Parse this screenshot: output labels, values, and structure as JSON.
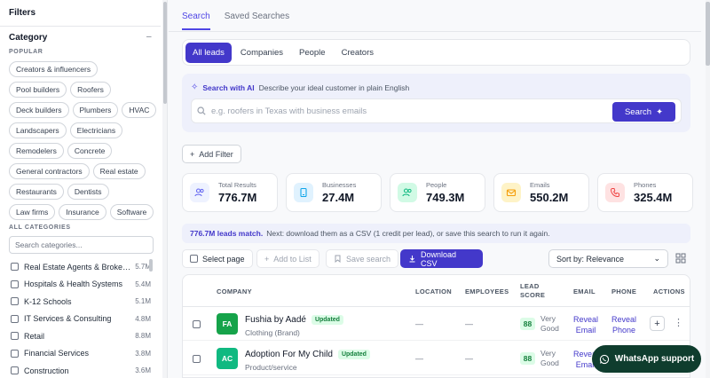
{
  "sidebar": {
    "title": "Filters",
    "category_title": "Category",
    "collapse_icon": "minus-icon",
    "popular_label": "POPULAR",
    "popular_chips": [
      "Creators & influencers",
      "Pool builders",
      "Roofers",
      "Deck builders",
      "Plumbers",
      "HVAC",
      "Landscapers",
      "Electricians",
      "Remodelers",
      "Concrete",
      "General contractors",
      "Real estate",
      "Restaurants",
      "Dentists",
      "Law firms",
      "Insurance",
      "Software"
    ],
    "all_categories_label": "ALL CATEGORIES",
    "search_placeholder": "Search categories...",
    "categories": [
      {
        "name": "Real Estate Agents & Broke…",
        "count": "5.7M"
      },
      {
        "name": "Hospitals & Health Systems",
        "count": "5.4M"
      },
      {
        "name": "K-12 Schools",
        "count": "5.1M"
      },
      {
        "name": "IT Services & Consulting",
        "count": "4.8M"
      },
      {
        "name": "Retail",
        "count": "8.8M"
      },
      {
        "name": "Financial Services",
        "count": "3.8M"
      },
      {
        "name": "Construction",
        "count": "3.6M"
      }
    ]
  },
  "tabs": [
    "Search",
    "Saved Searches"
  ],
  "segments": [
    "All leads",
    "Companies",
    "People",
    "Creators"
  ],
  "ai": {
    "label": "Search with AI",
    "description": "Describe your ideal customer in plain English",
    "placeholder": "e.g. roofers in Texas with business emails",
    "button": "Search"
  },
  "add_filter": "Add Filter",
  "stats": [
    {
      "label": "Total Results",
      "value": "776.7M",
      "icon": "users-icon",
      "color": "#6366f1",
      "bg": "#eef2ff"
    },
    {
      "label": "Businesses",
      "value": "27.4M",
      "icon": "building-icon",
      "color": "#0ea5e9",
      "bg": "#e0f2fe"
    },
    {
      "label": "People",
      "value": "749.3M",
      "icon": "people-icon",
      "color": "#10b981",
      "bg": "#d1fae5"
    },
    {
      "label": "Emails",
      "value": "550.2M",
      "icon": "mail-icon",
      "color": "#f59e0b",
      "bg": "#fef3c7"
    },
    {
      "label": "Phones",
      "value": "325.4M",
      "icon": "phone-icon",
      "color": "#ef4444",
      "bg": "#fee2e2"
    }
  ],
  "match": {
    "count": "776.7M leads match.",
    "text": "Next: download them as a CSV (1 credit per lead), or save this search to run it again."
  },
  "toolbar": {
    "select_page": "Select page",
    "add_to_list": "Add to List",
    "save_search": "Save search",
    "download": "Download CSV",
    "sort": "Sort by: Relevance"
  },
  "table": {
    "headers": {
      "company": "COMPANY",
      "location": "LOCATION",
      "employees": "EMPLOYEES",
      "lead_score_1": "LEAD",
      "lead_score_2": "SCORE",
      "email": "EMAIL",
      "phone": "PHONE",
      "actions": "ACTIONS"
    },
    "rows": [
      {
        "initials": "FA",
        "name": "Fushia by Aadé",
        "badge": "Updated",
        "sub": "Clothing (Brand)",
        "location": "—",
        "employees": "—",
        "score": "88",
        "score_1": "Very",
        "score_2": "Good",
        "email_1": "Reveal",
        "email_2": "Email",
        "phone_1": "Reveal",
        "phone_2": "Phone",
        "color": "#16a34a"
      },
      {
        "initials": "AC",
        "name": "Adoption For My Child",
        "badge": "Updated",
        "sub": "Product/service",
        "location": "—",
        "employees": "—",
        "score": "88",
        "score_1": "Very",
        "score_2": "Good",
        "email_1": "Reveal",
        "email_2": "Email",
        "phone_1": "",
        "phone_2": "",
        "color": "#10b981"
      }
    ]
  },
  "whatsapp": "WhatsApp support"
}
